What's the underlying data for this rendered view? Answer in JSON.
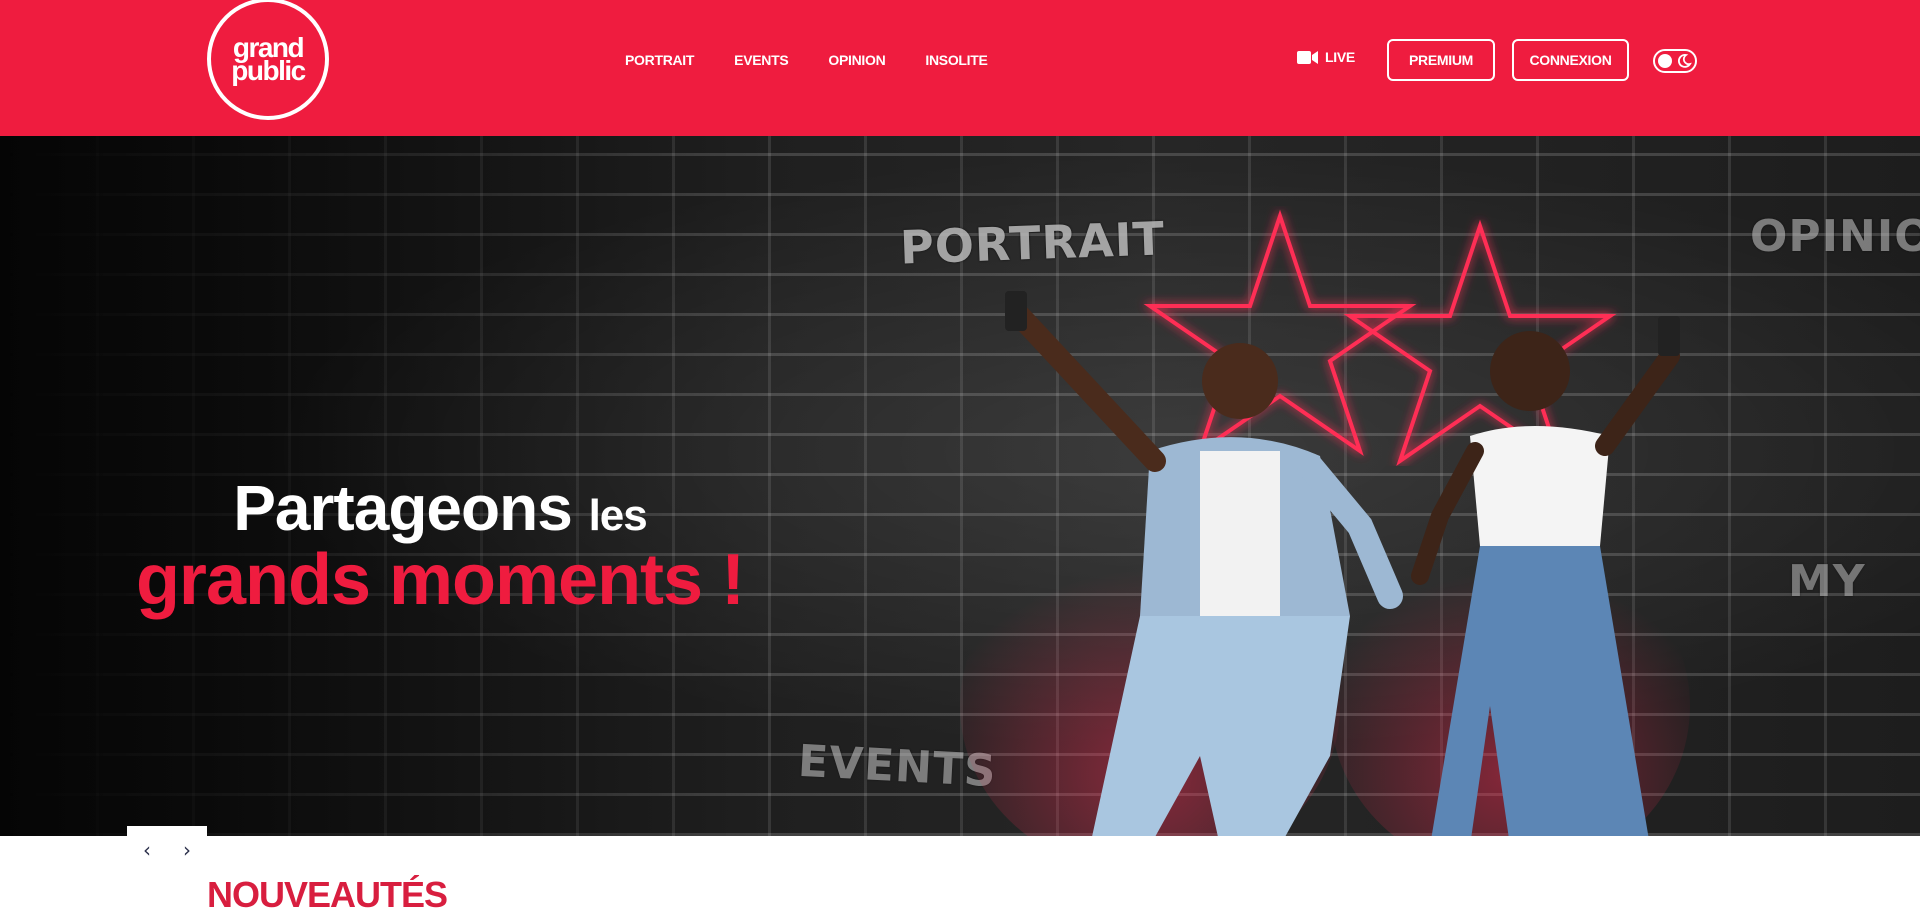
{
  "logo": {
    "line1": "grand",
    "line2": "public"
  },
  "nav": {
    "items": [
      {
        "label": "PORTRAIT"
      },
      {
        "label": "EVENTS"
      },
      {
        "label": "OPINION"
      },
      {
        "label": "INSOLITE"
      }
    ]
  },
  "header": {
    "live_label": "LIVE",
    "premium_label": "PREMIUM",
    "connexion_label": "CONNEXION",
    "theme_toggle": {
      "icon": "moon-icon",
      "state": "light"
    }
  },
  "hero": {
    "tagline_line1_big": "Partageons",
    "tagline_line1_small": "les",
    "tagline_line2": "grands moments !",
    "wall_words": [
      "PORTRAIT",
      "OPINIO",
      "EVENTS",
      "MY"
    ]
  },
  "carousel": {
    "prev_icon": "chevron-left-icon",
    "next_icon": "chevron-right-icon"
  },
  "section": {
    "title": "NOUVEAUTÉS"
  },
  "colors": {
    "brand_red": "#ef1c3f",
    "title_red": "#d81e3f",
    "controls_navy": "#2b2f4a"
  }
}
